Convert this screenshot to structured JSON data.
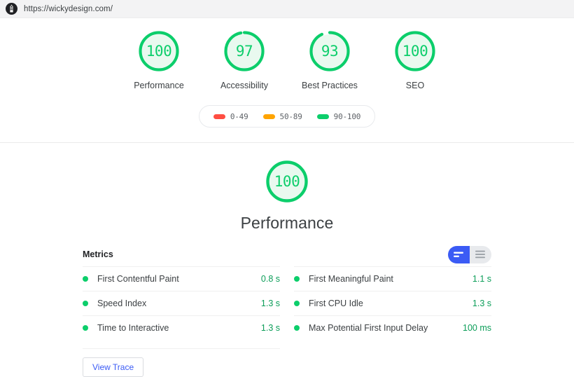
{
  "urlbar": {
    "logo_name": "lighthouse-logo",
    "url": "https://wickydesign.com/"
  },
  "colors": {
    "pass": "#0cce6b",
    "average": "#ffa400",
    "fail": "#ff4e42",
    "accent": "#3b5bf5",
    "value_text": "#0b9d58"
  },
  "summary": {
    "gauges": [
      {
        "score": "100",
        "label": "Performance",
        "value": 100
      },
      {
        "score": "97",
        "label": "Accessibility",
        "value": 97
      },
      {
        "score": "93",
        "label": "Best Practices",
        "value": 93
      },
      {
        "score": "100",
        "label": "SEO",
        "value": 100
      }
    ],
    "legend": [
      {
        "range": "0-49",
        "color": "#ff4e42"
      },
      {
        "range": "50-89",
        "color": "#ffa400"
      },
      {
        "range": "90-100",
        "color": "#0cce6b"
      }
    ]
  },
  "category": {
    "score": "100",
    "value": 100,
    "title": "Performance"
  },
  "metrics": {
    "title": "Metrics",
    "toggle": {
      "active_name": "simple-view-icon",
      "inactive_name": "expanded-view-icon",
      "active": "simple"
    },
    "left": [
      {
        "name": "First Contentful Paint",
        "value": "0.8 s",
        "status": "pass"
      },
      {
        "name": "Speed Index",
        "value": "1.3 s",
        "status": "pass"
      },
      {
        "name": "Time to Interactive",
        "value": "1.3 s",
        "status": "pass"
      }
    ],
    "right": [
      {
        "name": "First Meaningful Paint",
        "value": "1.1 s",
        "status": "pass"
      },
      {
        "name": "First CPU Idle",
        "value": "1.3 s",
        "status": "pass"
      },
      {
        "name": "Max Potential First Input Delay",
        "value": "100 ms",
        "status": "pass"
      }
    ],
    "view_trace_label": "View Trace"
  }
}
